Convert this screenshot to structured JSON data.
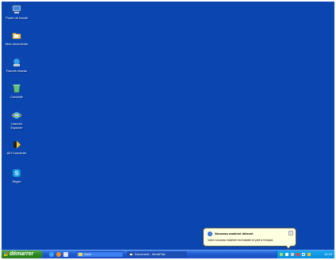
{
  "desktop": {
    "background_color": "#0a45b0",
    "icons": [
      {
        "label": "Poste de travail",
        "icon": "my-computer-icon"
      },
      {
        "label": "Mes documents",
        "icon": "my-documents-icon"
      },
      {
        "label": "Favoris réseau",
        "icon": "network-places-icon"
      },
      {
        "label": "Corbeille",
        "icon": "recycle-bin-icon"
      },
      {
        "label": "Internet\nExplorer",
        "icon": "internet-explorer-icon"
      },
      {
        "label": "AVI Converter",
        "icon": "avi-converter-icon"
      },
      {
        "label": "Skype",
        "icon": "skype-icon"
      }
    ]
  },
  "taskbar": {
    "start_label": "démarrer",
    "quick_launch": [
      "internet-explorer-icon",
      "media-player-icon",
      "show-desktop-icon"
    ],
    "tasks": [
      {
        "label": "Save",
        "icon": "folder-icon",
        "active": false
      },
      {
        "label": "Document - WordPad",
        "icon": "wordpad-icon",
        "active": true
      }
    ],
    "tray": {
      "icons": [
        "hardware-icon",
        "network-icon",
        "volume-icon",
        "security-icon",
        "skype-tray-icon",
        "display-icon"
      ],
      "clock": "14:24"
    }
  },
  "notification": {
    "title": "Nouveau matériel détecté",
    "message": "Votre nouveau matériel est installé et prêt à l'emploi.",
    "close_label": "x",
    "info_glyph": "i"
  }
}
